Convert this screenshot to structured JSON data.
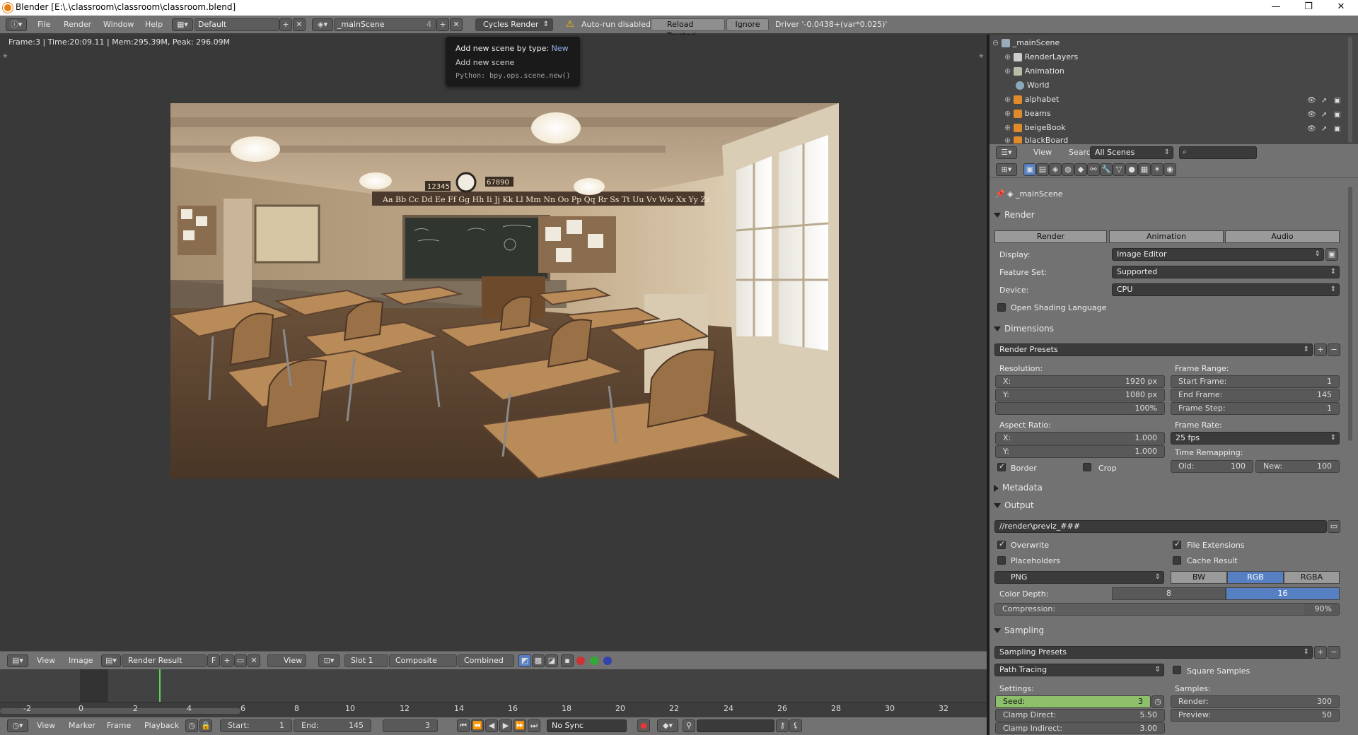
{
  "window": {
    "title": "Blender [E:\\.\\classroom\\classroom\\classroom.blend]",
    "min": "—",
    "max": "❐",
    "close": "✕"
  },
  "menu": {
    "items": [
      "File",
      "Render",
      "Window",
      "Help"
    ]
  },
  "info": {
    "layout": "Default",
    "scene": "_mainScene",
    "scene_users": "4",
    "engine": "Cycles Render",
    "warning": "Auto-run disabled",
    "reload": "Reload Trusted",
    "ignore": "Ignore",
    "driver": "Driver '-0.0438+(var*0.025)'"
  },
  "tooltip": {
    "line1_label": "Add new scene by type:",
    "line1_value": "New",
    "line2": "Add new scene",
    "line3": "Python: bpy.ops.scene.new()"
  },
  "viewport": {
    "stats": "Frame:3 | Time:20:09.11 | Mem:295.39M, Peak: 296.09M"
  },
  "render_image": {
    "number_card_left": "12345",
    "number_card_right": "67890",
    "alphabet": "Aa Bb   Cc Dd Ee Ff Gg Hh Ii Jj Kk Ll Mm Nn Oo Pp Qq Rr Ss Tt Uu Vv Ww Xx Yy Zz"
  },
  "image_header": {
    "view": "View",
    "image": "Image",
    "image_name": "Render Result",
    "f": "F",
    "view_sel": "View",
    "slot": "Slot 1",
    "composite": "Composite",
    "pass": "Combined"
  },
  "timeline": {
    "ticks": [
      "-2",
      "0",
      "2",
      "4",
      "6",
      "8",
      "10",
      "12",
      "14",
      "16",
      "18",
      "20",
      "22",
      "24",
      "26",
      "28",
      "30",
      "32"
    ],
    "current_frame": 3,
    "view": "View",
    "marker": "Marker",
    "frame": "Frame",
    "playback": "Playback",
    "start_label": "Start:",
    "start": "1",
    "end_label": "End:",
    "end": "145",
    "cur": "3",
    "sync": "No Sync"
  },
  "outliner": {
    "items": [
      {
        "name": "_mainScene",
        "icon": "scene-icon"
      },
      {
        "name": "RenderLayers",
        "icon": "render-layers-icon"
      },
      {
        "name": "Animation",
        "icon": "animation-icon"
      },
      {
        "name": "World",
        "icon": "world-icon"
      },
      {
        "name": "alphabet",
        "icon": "mesh-icon"
      },
      {
        "name": "beams",
        "icon": "mesh-icon"
      },
      {
        "name": "beigeBook",
        "icon": "mesh-icon"
      },
      {
        "name": "blackBoard",
        "icon": "mesh-icon"
      }
    ],
    "header": {
      "view": "View",
      "search": "Search",
      "filter": "All Scenes"
    }
  },
  "properties": {
    "context": "_mainScene",
    "render": {
      "title": "Render",
      "tabs": [
        "Render",
        "Animation",
        "Audio"
      ],
      "display_label": "Display:",
      "display": "Image Editor",
      "feature_label": "Feature Set:",
      "feature": "Supported",
      "device_label": "Device:",
      "device": "CPU",
      "osl": "Open Shading Language"
    },
    "dimensions": {
      "title": "Dimensions",
      "presets": "Render Presets",
      "resolution_label": "Resolution:",
      "res_x_label": "X:",
      "res_x": "1920 px",
      "res_y_label": "Y:",
      "res_y": "1080 px",
      "res_pct": "100%",
      "aspect_label": "Aspect Ratio:",
      "asp_x_label": "X:",
      "asp_x": "1.000",
      "asp_y_label": "Y:",
      "asp_y": "1.000",
      "border": "Border",
      "crop": "Crop",
      "frame_range_label": "Frame Range:",
      "start_label": "Start Frame:",
      "start": "1",
      "end_label": "End Frame:",
      "end": "145",
      "step_label": "Frame Step:",
      "step": "1",
      "frame_rate_label": "Frame Rate:",
      "frame_rate": "25 fps",
      "remap_label": "Time Remapping:",
      "old_label": "Old:",
      "old": "100",
      "new_label": "New:",
      "new": "100"
    },
    "metadata": {
      "title": "Metadata"
    },
    "output": {
      "title": "Output",
      "path": "//render\\previz_###",
      "overwrite": "Overwrite",
      "file_ext": "File Extensions",
      "placeholders": "Placeholders",
      "cache": "Cache Result",
      "format": "PNG",
      "bw": "BW",
      "rgb": "RGB",
      "rgba": "RGBA",
      "depth_label": "Color Depth:",
      "depth8": "8",
      "depth16": "16",
      "compression_label": "Compression:",
      "compression": "90%",
      "compression_fraction": 0.9
    },
    "sampling": {
      "title": "Sampling",
      "presets": "Sampling Presets",
      "integrator": "Path Tracing",
      "square": "Square Samples",
      "settings_label": "Settings:",
      "seed_label": "Seed:",
      "seed": "3",
      "clamp_direct_label": "Clamp Direct:",
      "clamp_direct": "5.50",
      "clamp_indirect_label": "Clamp Indirect:",
      "clamp_indirect": "3.00",
      "samples_label": "Samples:",
      "render_label": "Render:",
      "render": "300",
      "preview_label": "Preview:",
      "preview": "50"
    }
  },
  "colors": {
    "accent": "#5680c2",
    "seed_green": "#8ec06c",
    "playhead": "#5ad45a"
  }
}
